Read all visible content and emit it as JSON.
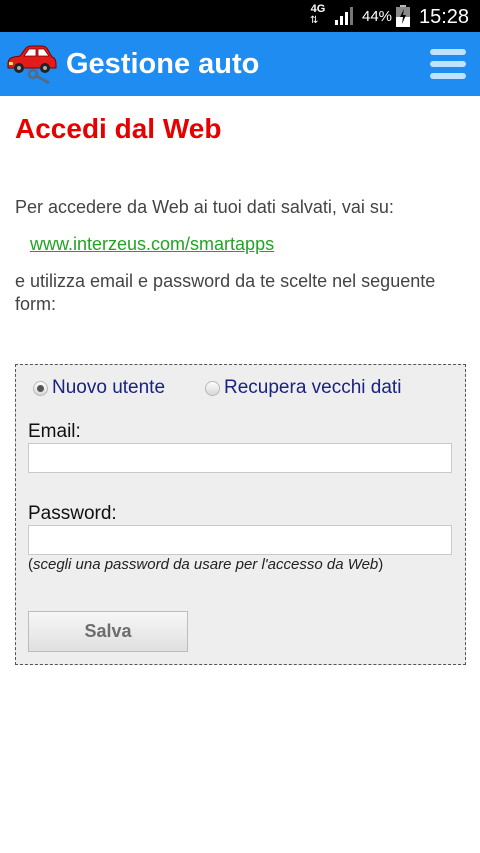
{
  "status_bar": {
    "network": "4G",
    "network_arrows": "⇅",
    "battery_percent": "44%",
    "time": "15:28",
    "icons": [
      "signal-icon",
      "battery-charging-icon"
    ]
  },
  "app_bar": {
    "title": "Gestione auto",
    "logo_icon": "car-wrench-icon",
    "menu_icon": "hamburger-menu-icon",
    "color": "#1e8cf0"
  },
  "content": {
    "title": "Accedi dal Web",
    "intro": "Per accedere da Web ai tuoi dati salvati, vai su:",
    "link": "www.interzeus.com/smartapps",
    "intro2": "e utilizza email e password da te scelte nel seguente form:"
  },
  "form": {
    "radio_new_label": "Nuovo utente",
    "radio_new_checked": true,
    "radio_recover_label": "Recupera vecchi dati",
    "radio_recover_checked": false,
    "email_label": "Email:",
    "email_value": "",
    "password_label": "Password:",
    "password_value": "",
    "hint_open": "(",
    "hint_text": "scegli una password da usare per l'accesso da Web",
    "hint_close": ")",
    "save_label": "Salva"
  },
  "colors": {
    "title_red": "#e60000",
    "link_green": "#22a322",
    "radio_label_blue": "#1a237e"
  }
}
